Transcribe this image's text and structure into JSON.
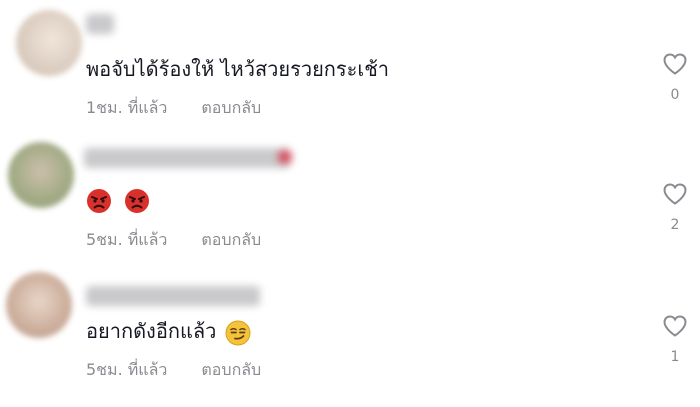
{
  "comments": [
    {
      "text": "พอจับได้ร้องให้ ไหว้สวยรวยกระเช้า",
      "time": "1ชม. ที่แล้ว",
      "reply_label": "ตอบกลับ",
      "likes": "0",
      "avatar_color": "#d9c9bb"
    },
    {
      "text": "",
      "emoji": [
        "angry-face",
        "angry-face"
      ],
      "time": "5ชม. ที่แล้ว",
      "reply_label": "ตอบกลับ",
      "likes": "2",
      "avatar_color": "#9aa37a"
    },
    {
      "text": "อยากดังอีกแล้ว",
      "emoji": [
        "smirking-face"
      ],
      "time": "5ชม. ที่แล้ว",
      "reply_label": "ตอบกลับ",
      "likes": "1",
      "avatar_color": "#c9a894"
    }
  ],
  "colors": {
    "text": "#161823",
    "secondary": "#8a8b91",
    "angry_emoji": "#d9302c",
    "smirk_emoji": "#f5c33b"
  }
}
